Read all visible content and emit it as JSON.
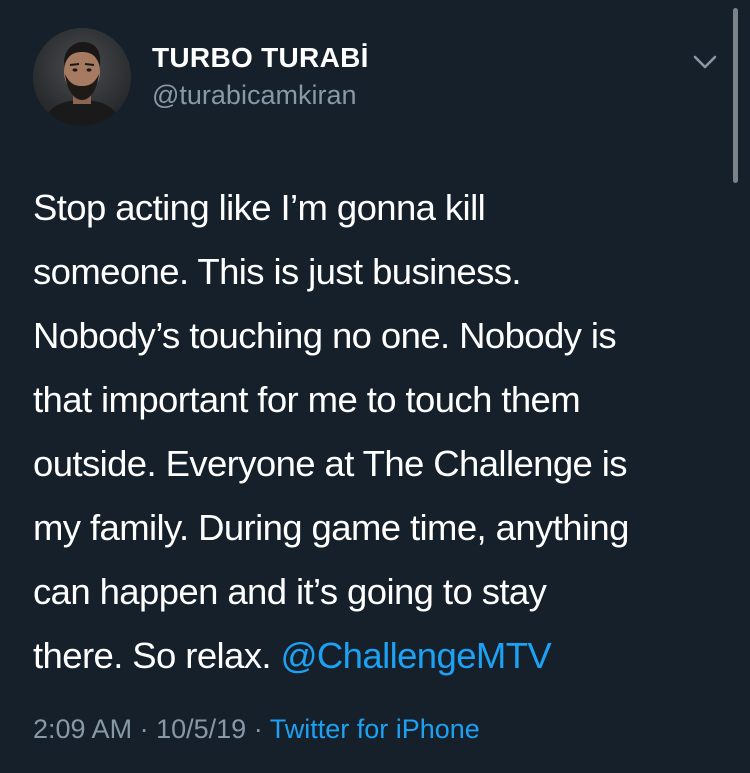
{
  "user": {
    "display_name": "TURBO TURABİ",
    "handle": "@turabicamkiran",
    "avatar_icon": "profile-photo"
  },
  "menu": {
    "icon": "chevron-down-icon"
  },
  "tweet": {
    "lines": [
      "Stop acting like I’m gonna kill",
      "someone. This is just business.",
      "Nobody’s touching no one. Nobody is",
      "that important for me to touch them",
      "outside. Everyone at The Challenge is",
      "my family. During game time, anything",
      "can happen and it’s going to stay",
      "there. So relax."
    ],
    "mention": "@ChallengeMTV"
  },
  "meta": {
    "time": "2:09 AM",
    "separator": "·",
    "date": "10/5/19",
    "source": "Twitter for iPhone"
  },
  "colors": {
    "background": "#15202b",
    "text": "#ffffff",
    "secondary": "#8899a6",
    "link": "#1da1f2"
  }
}
